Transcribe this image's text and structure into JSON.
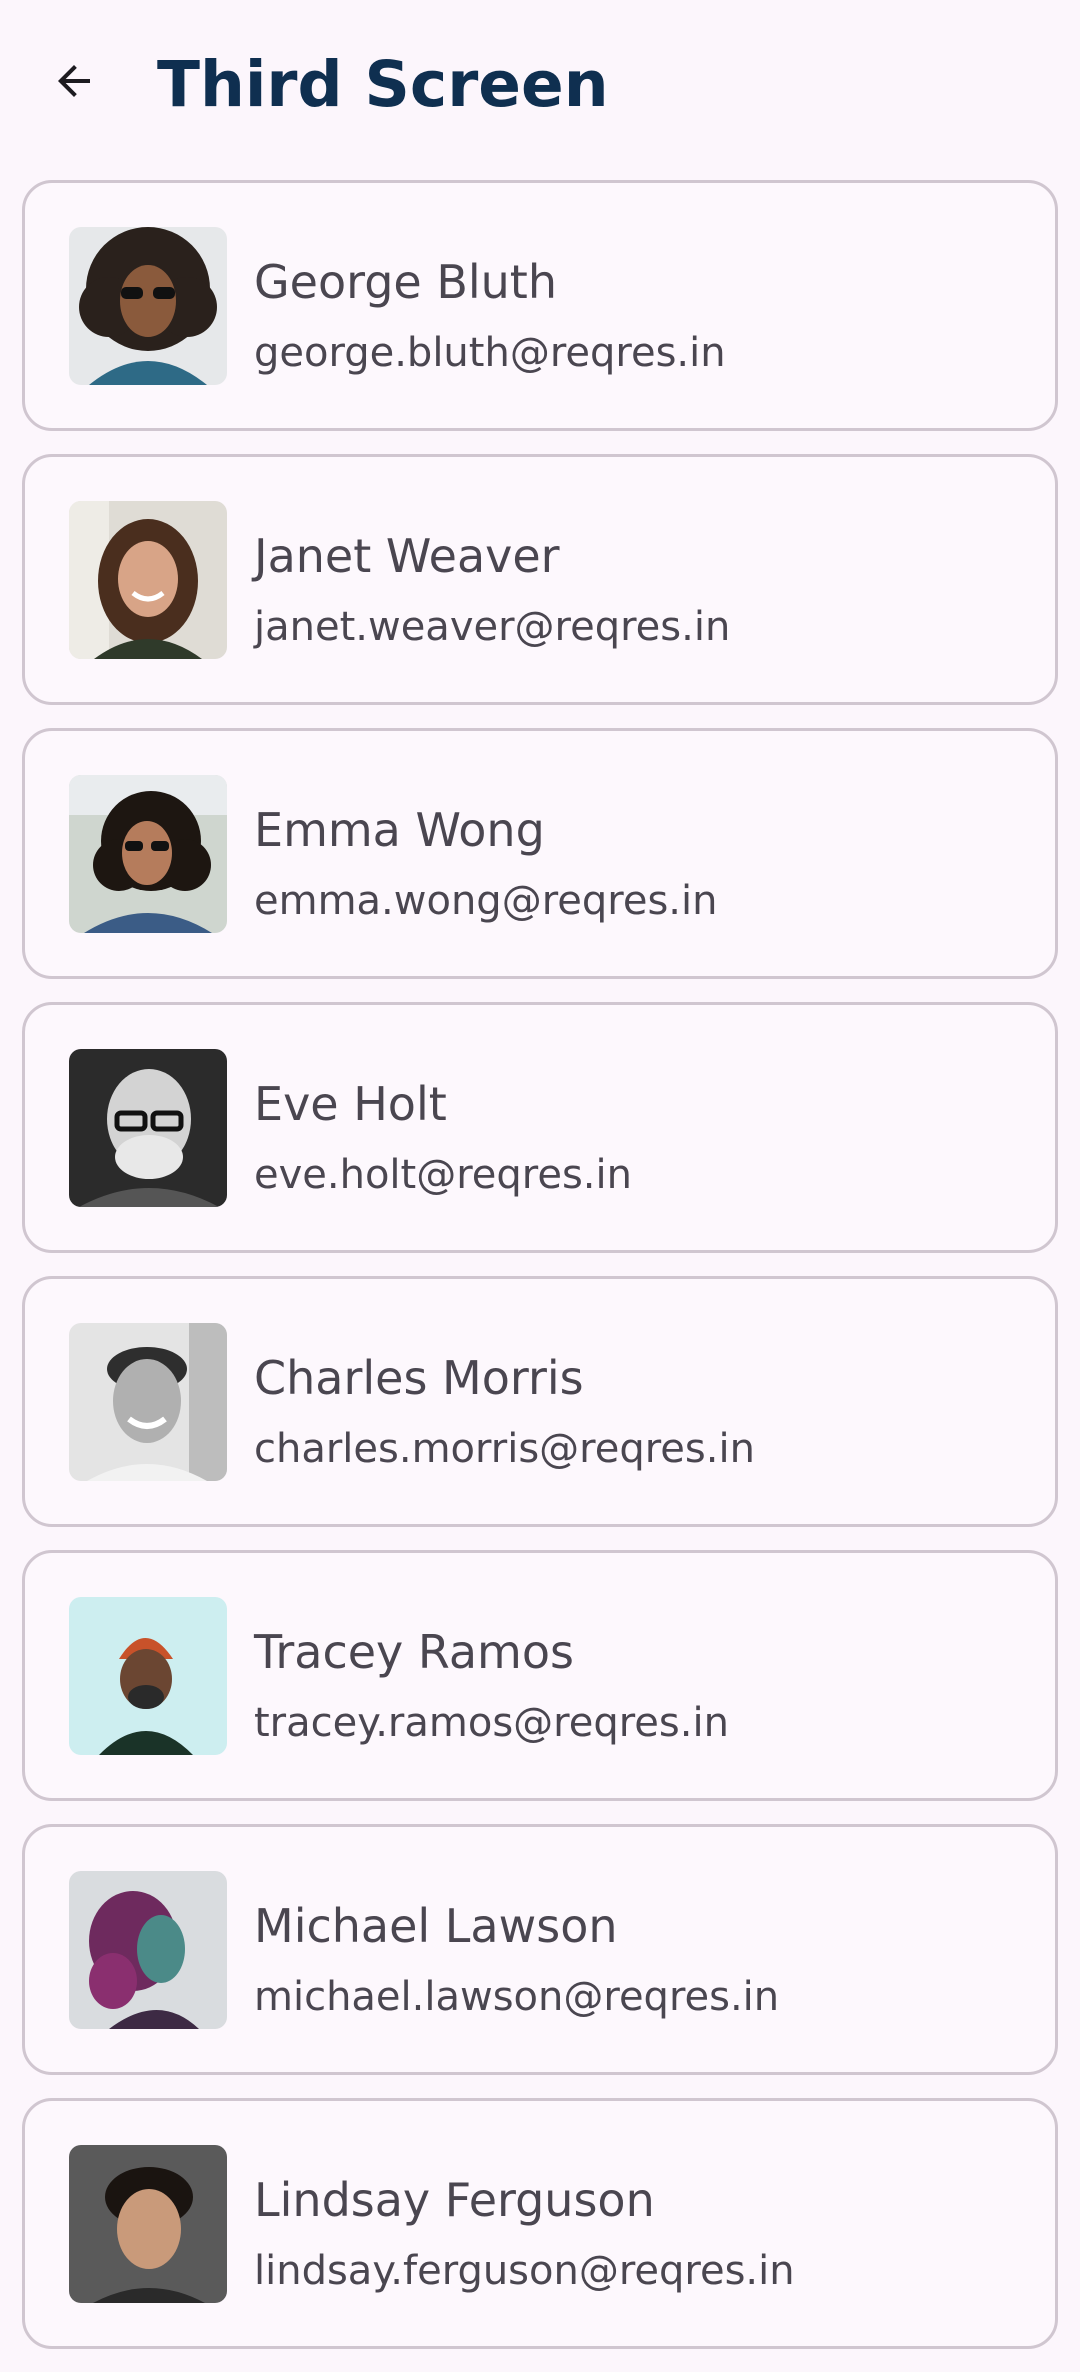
{
  "header": {
    "title": "Third Screen",
    "back_icon": "arrow-back-icon"
  },
  "colors": {
    "background": "#fcf6fc",
    "title": "#0f2f50",
    "card_border": "#d0c6d0",
    "text": "#4a4650"
  },
  "users": [
    {
      "name": "George Bluth",
      "email": "george.bluth@reqres.in"
    },
    {
      "name": "Janet Weaver",
      "email": "janet.weaver@reqres.in"
    },
    {
      "name": "Emma Wong",
      "email": "emma.wong@reqres.in"
    },
    {
      "name": "Eve Holt",
      "email": "eve.holt@reqres.in"
    },
    {
      "name": "Charles Morris",
      "email": "charles.morris@reqres.in"
    },
    {
      "name": "Tracey Ramos",
      "email": "tracey.ramos@reqres.in"
    },
    {
      "name": "Michael Lawson",
      "email": "michael.lawson@reqres.in"
    },
    {
      "name": "Lindsay Ferguson",
      "email": "lindsay.ferguson@reqres.in"
    }
  ]
}
